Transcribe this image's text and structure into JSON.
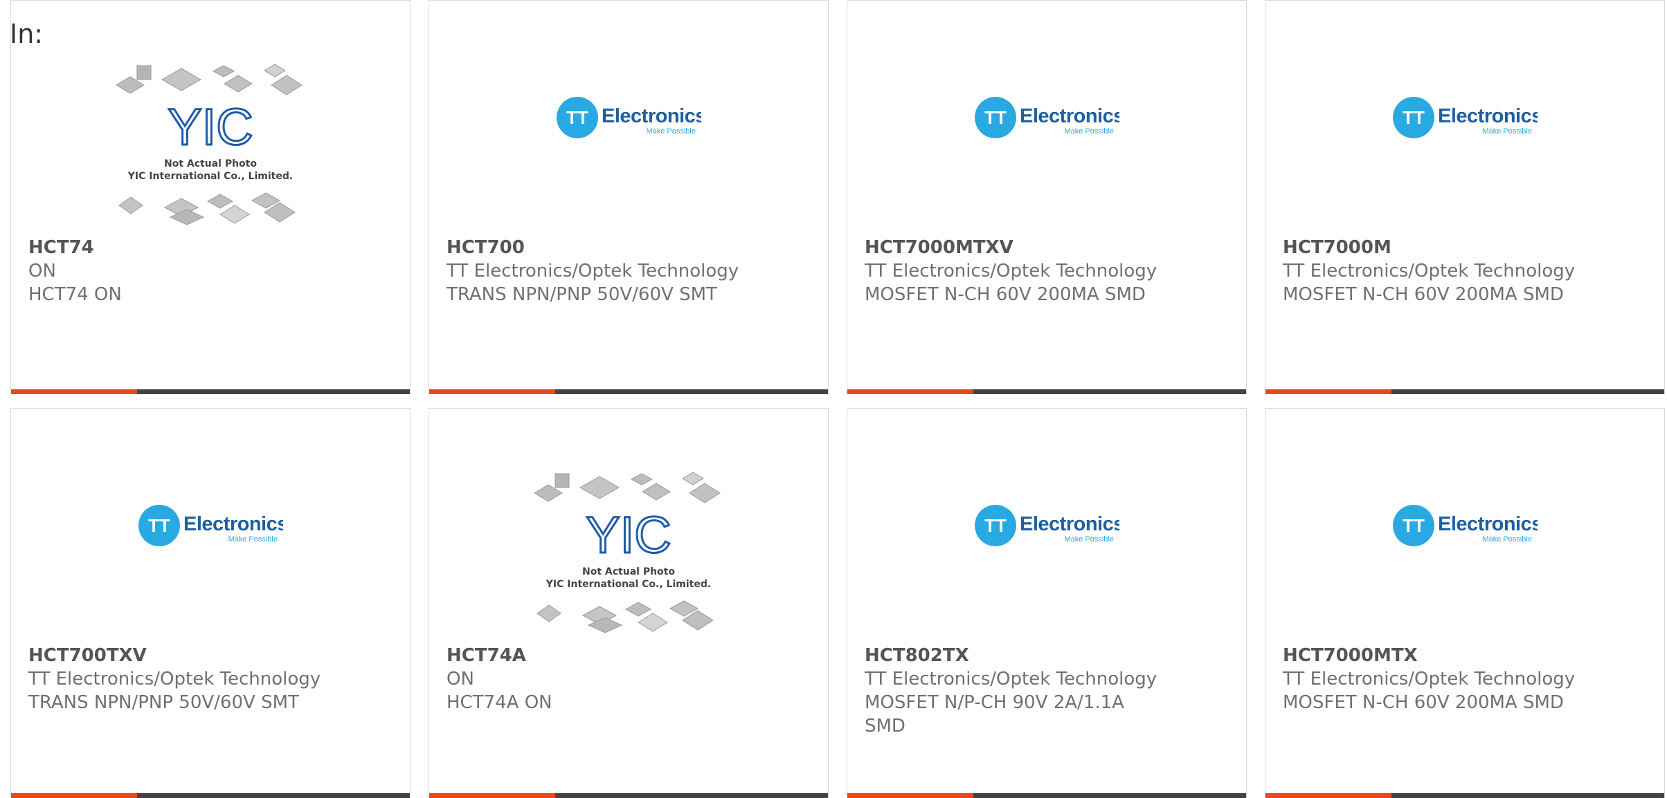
{
  "heading": "In:",
  "colors": {
    "accent": "#e64a19",
    "bar_dark": "#444444",
    "tt_blue": "#29a9e1",
    "tt_text": "#1f5fa0",
    "yic_blue": "#1e5aa8"
  },
  "logos": {
    "tt": {
      "brand": "Electronics",
      "mark": "TT",
      "tagline": "Make Possible"
    },
    "yic": {
      "mark": "YIC",
      "line1": "Not Actual Photo",
      "line2": "YIC International Co., Limited."
    }
  },
  "products": [
    {
      "part": "HCT74",
      "maker": "ON",
      "desc": "HCT74 ON",
      "image": "yic"
    },
    {
      "part": "HCT700",
      "maker": "TT Electronics/Optek Technology",
      "desc": "TRANS NPN/PNP 50V/60V SMT",
      "image": "tt"
    },
    {
      "part": "HCT7000MTXV",
      "maker": "TT Electronics/Optek Technology",
      "desc": "MOSFET N-CH 60V 200MA SMD",
      "image": "tt"
    },
    {
      "part": "HCT7000M",
      "maker": "TT Electronics/Optek Technology",
      "desc": "MOSFET N-CH 60V 200MA SMD",
      "image": "tt"
    },
    {
      "part": "HCT700TXV",
      "maker": "TT Electronics/Optek Technology",
      "desc": "TRANS NPN/PNP 50V/60V SMT",
      "image": "tt"
    },
    {
      "part": "HCT74A",
      "maker": "ON",
      "desc": "HCT74A ON",
      "image": "yic"
    },
    {
      "part": "HCT802TX",
      "maker": "TT Electronics/Optek Technology",
      "desc": "MOSFET N/P-CH 90V 2A/1.1A SMD",
      "image": "tt"
    },
    {
      "part": "HCT7000MTX",
      "maker": "TT Electronics/Optek Technology",
      "desc": "MOSFET N-CH 60V 200MA SMD",
      "image": "tt"
    }
  ]
}
